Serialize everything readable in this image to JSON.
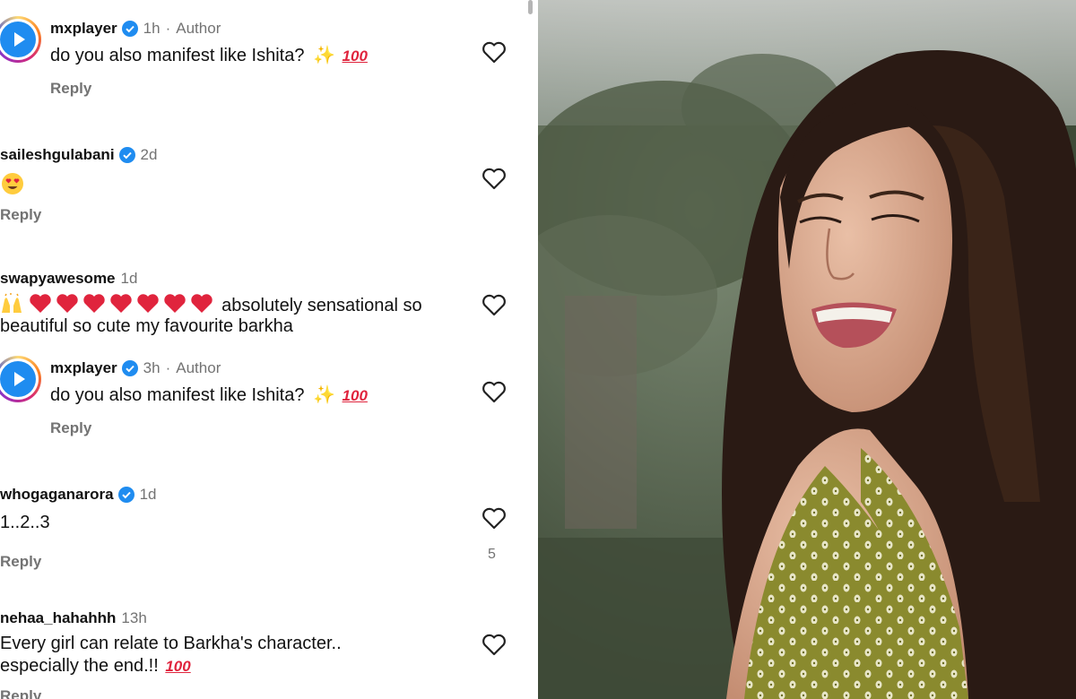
{
  "comments": [
    {
      "username": "mxplayer",
      "verified": true,
      "time": "1h",
      "author_label": "Author",
      "text": "do you also manifest like Ishita?",
      "has_sparkle": true,
      "has_hundred": true,
      "reply": "Reply"
    },
    {
      "username": "saileshgulabani",
      "verified": true,
      "time": "2d",
      "text": "",
      "emoji": "heart-eyes-emoji",
      "reply": "Reply"
    },
    {
      "username": "swapyawesome",
      "verified": false,
      "time": "1d",
      "lead_emoji": "raising-hands-emoji",
      "hearts_count": 7,
      "line1": "absolutely sensational so",
      "line2": "beautiful so cute my favourite barkha"
    },
    {
      "username": "mxplayer",
      "verified": true,
      "time": "3h",
      "author_label": "Author",
      "text": "do you also manifest like Ishita?",
      "reply": "Reply"
    },
    {
      "username": "whogaganarora",
      "verified": true,
      "time": "1d",
      "text": "1..2..3",
      "reply": "Reply",
      "likes": "5"
    },
    {
      "username": "nehaa_hahahhh",
      "verified": false,
      "time": "13h",
      "line1": "Every girl can relate to Barkha's character..",
      "line2": "especially the end.!!",
      "reply": "Reply"
    }
  ],
  "separator": "·",
  "hundred_text": "100",
  "sparkle_text": "✨",
  "colors": {
    "accent": "#1f8cf0",
    "muted": "#737373",
    "heart": "#e0243d"
  },
  "photo": {
    "description_icon": "woman-smiling-photo"
  }
}
